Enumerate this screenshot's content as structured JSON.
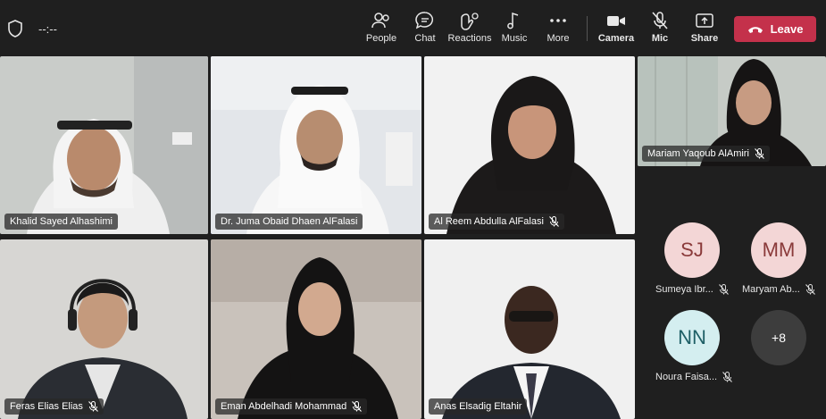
{
  "topbar": {
    "timer": "--:--",
    "tools": [
      {
        "label": "People",
        "icon": "people-icon"
      },
      {
        "label": "Chat",
        "icon": "chat-icon"
      },
      {
        "label": "Reactions",
        "icon": "reactions-icon"
      },
      {
        "label": "Music",
        "icon": "music-icon"
      },
      {
        "label": "More",
        "icon": "more-icon"
      },
      {
        "label": "Camera",
        "icon": "camera-icon"
      },
      {
        "label": "Mic",
        "icon": "mic-off-icon"
      },
      {
        "label": "Share",
        "icon": "share-icon"
      }
    ],
    "leave_label": "Leave"
  },
  "tiles": [
    {
      "name": "Khalid Sayed Alhashimi",
      "muted": false,
      "active": false
    },
    {
      "name": "Dr. Juma Obaid Dhaen AlFalasi",
      "muted": false,
      "active": true
    },
    {
      "name": "Al Reem Abdulla AlFalasi",
      "muted": true,
      "active": false
    },
    {
      "name": "Mariam Yaqoub AlAmiri",
      "muted": true,
      "active": false
    },
    {
      "name": "Feras Elias Elias",
      "muted": true,
      "active": false
    },
    {
      "name": "Eman Abdelhadi Mohammad",
      "muted": true,
      "active": false
    },
    {
      "name": "Anas Elsadig Eltahir",
      "muted": false,
      "active": false
    }
  ],
  "avatars": [
    {
      "initials": "SJ",
      "name": "Sumeya Ibr...",
      "muted": true
    },
    {
      "initials": "MM",
      "name": "Maryam Ab...",
      "muted": true
    },
    {
      "initials": "NN",
      "name": "Noura Faisa...",
      "muted": true
    }
  ],
  "overflow": {
    "label": "+8"
  },
  "colors": {
    "leave": "#c4314b",
    "active_border": "#7b83eb",
    "avatar_pink": "#f3d6d6",
    "avatar_teal": "#d4eef0"
  }
}
